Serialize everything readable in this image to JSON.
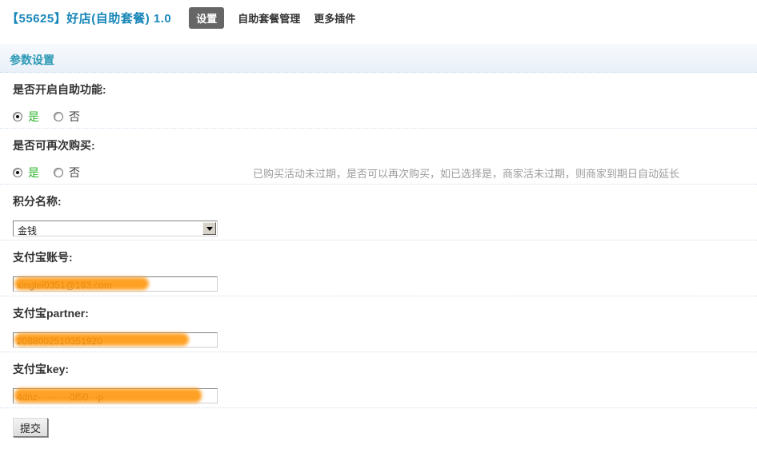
{
  "header": {
    "title": "【55625】好店(自助套餐) 1.0",
    "tabs": [
      {
        "label": "设置",
        "active": true
      },
      {
        "label": "自助套餐管理",
        "active": false
      },
      {
        "label": "更多插件",
        "active": false
      }
    ]
  },
  "section": {
    "title": "参数设置"
  },
  "form": {
    "self_service": {
      "label": "是否开启自助功能:",
      "yes": "是",
      "no": "否",
      "selected": "是"
    },
    "rebuy": {
      "label": "是否可再次购买:",
      "yes": "是",
      "no": "否",
      "selected": "是",
      "hint": "已购买活动未过期，是否可以再次购买，如已选择是，商家活未过期，则商家到期日自动延长"
    },
    "points_name": {
      "label": "积分名称:",
      "value": "金钱"
    },
    "alipay_account": {
      "label": "支付宝账号:",
      "value": "xinglei0351@163.com",
      "redacted": true
    },
    "alipay_partner": {
      "label": "支付宝partner:",
      "value": "2088002510351920",
      "redacted": true
    },
    "alipay_key": {
      "label": "支付宝key:",
      "value": "4dnz··········0f50···p",
      "redacted": true
    },
    "submit_label": "提交"
  },
  "colors": {
    "title_blue": "#1886b8",
    "section_teal": "#2e9ab6",
    "active_tab_bg": "#666666",
    "yes_green": "#2db52d",
    "hint_gray": "#9c9c9c",
    "redaction_orange": "#ff9100",
    "dotted_border": "#cfdeec"
  }
}
